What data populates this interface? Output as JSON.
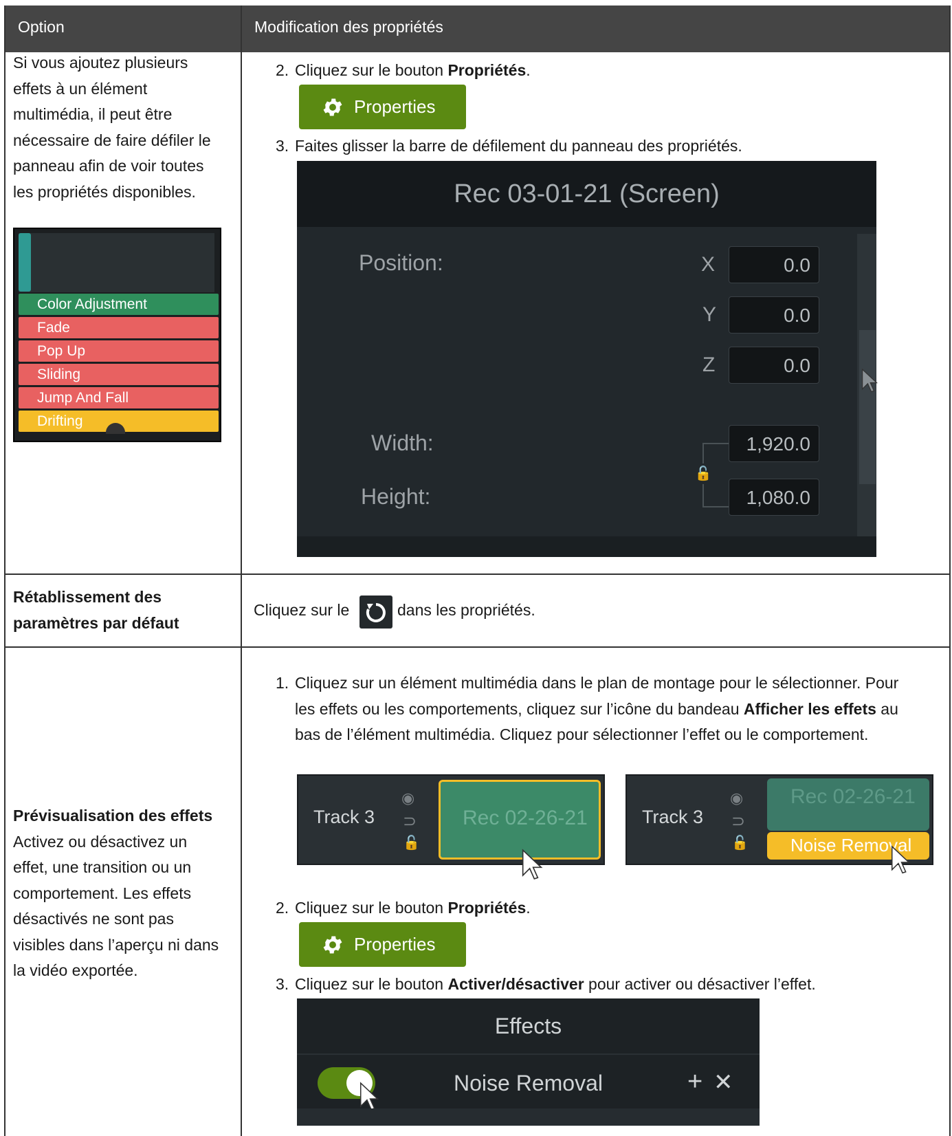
{
  "header": {
    "col1": "Option",
    "col2": "Modification des propriétés"
  },
  "row1": {
    "left_text": "Si vous ajoutez plusieurs effets à un élément multimédia, il peut être nécessaire de faire défiler le panneau afin de voir toutes les propriétés disponibles.",
    "stack_items": [
      "Color Adjustment",
      "Fade",
      "Pop Up",
      "Sliding",
      "Jump And Fall",
      "Drifting"
    ],
    "step2_prefix": "Cliquez sur le bouton ",
    "step2_bold": "Propriétés",
    "step2_suffix": ".",
    "properties_label": "Properties",
    "step3_text": "Faites glisser la barre de défilement du panneau des propriétés.",
    "panel": {
      "title": "Rec 03-01-21 (Screen)",
      "position_label": "Position:",
      "x_label": "X",
      "x_value": "0.0",
      "y_label": "Y",
      "y_value": "0.0",
      "z_label": "Z",
      "z_value": "0.0",
      "width_label": "Width:",
      "width_value": "1,920.0",
      "height_label": "Height:",
      "height_value": "1,080.0"
    }
  },
  "row2": {
    "left_bold": "Rétablissement des paramètres par défaut",
    "text_before": "Cliquez sur le",
    "text_after": "dans les propriétés."
  },
  "row3": {
    "left_bold": "Prévisualisation des effets",
    "left_text": "Activez ou désactivez un effet, une transition ou un comportement. Les effets désactivés ne sont pas visibles dans l’aperçu ni dans la vidéo exportée.",
    "step1_a": "Cliquez sur un élément multimédia dans le plan de montage pour le sélectionner. Pour les effets ou les comportements, cliquez sur l’icône du bandeau ",
    "step1_bold": "Afficher les effets",
    "step1_b": " au bas de l’élément multimédia. Cliquez pour sélectionner l’effet ou le comportement.",
    "track_name": "Track 3",
    "clip_label": "Rec 02-26-21",
    "effect_label": "Noise Removal",
    "step2_prefix": "Cliquez sur le bouton ",
    "step2_bold": "Propriétés",
    "step2_suffix": ".",
    "properties_label": "Properties",
    "step3_prefix": "Cliquez sur le bouton ",
    "step3_bold": "Activer/désactiver",
    "step3_suffix": " pour activer ou désactiver l’effet.",
    "effects_title": "Effects",
    "effects_item": "Noise Removal"
  },
  "step_numbers": {
    "one": "1.",
    "two": "2.",
    "three": "3."
  },
  "colors": {
    "header_bg": "#454545",
    "properties_green": "#5b8a12",
    "clip_green": "#3c8a68",
    "effect_yellow": "#f5bd28",
    "effect_red": "#e86161"
  }
}
